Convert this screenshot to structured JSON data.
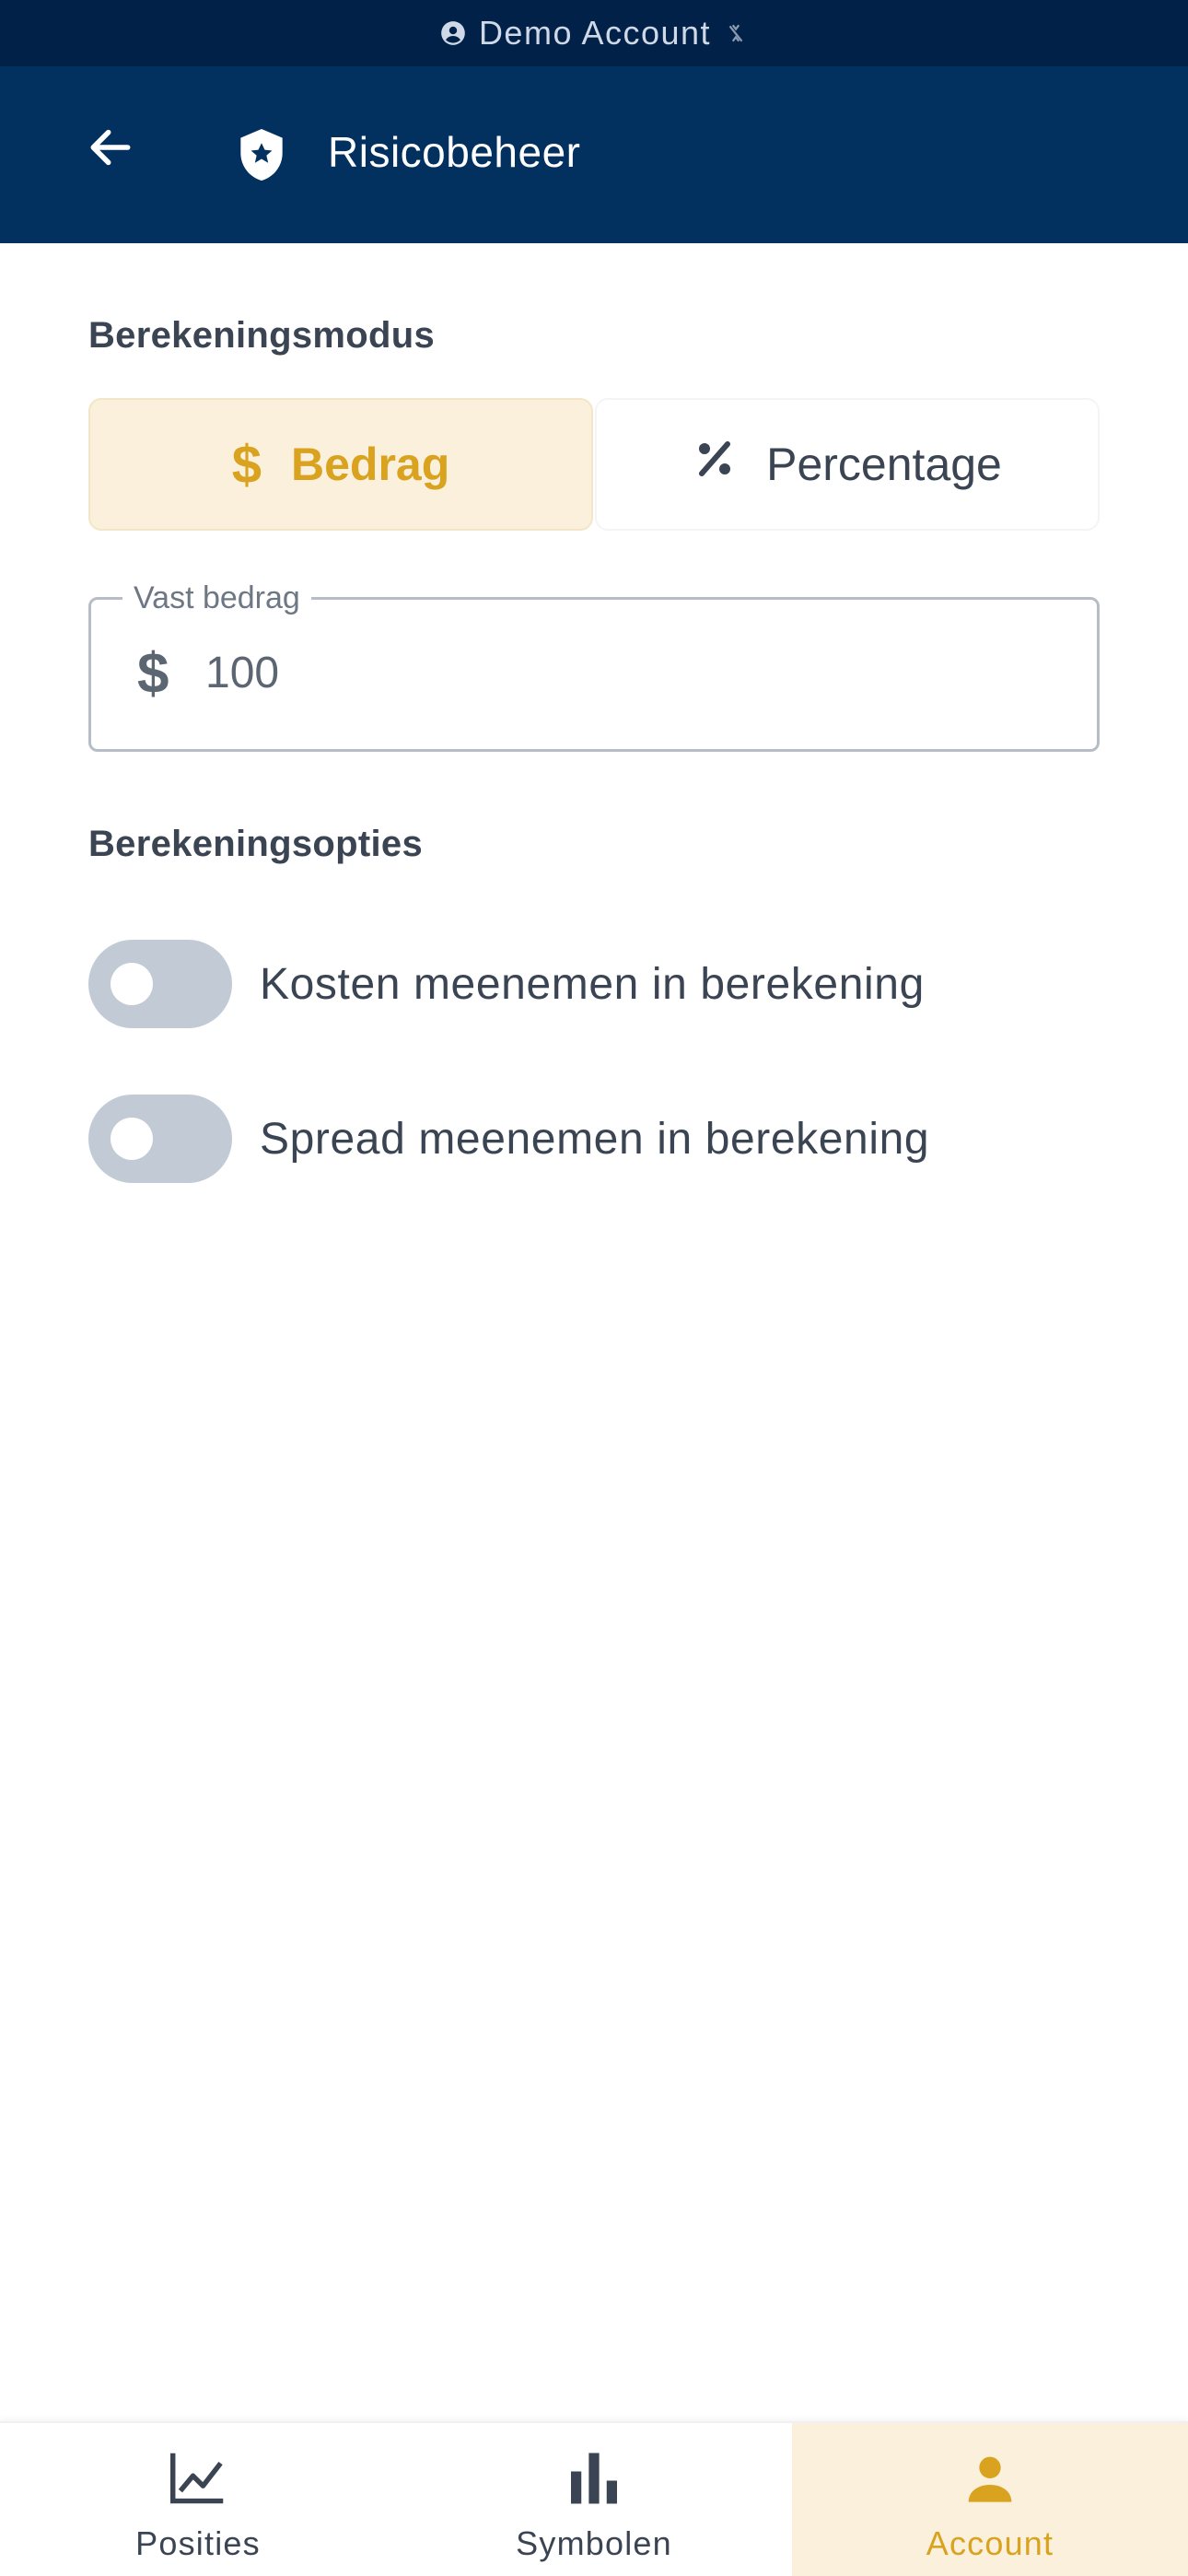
{
  "banner": {
    "text": "Demo Account",
    "user_icon": "account-circle-icon",
    "status_icon": "sync-off-icon"
  },
  "app_bar": {
    "title": "Risicobeheer",
    "back_icon": "arrow-left-icon",
    "title_icon": "shield-star-icon"
  },
  "mode": {
    "section_label": "Berekeningsmodus",
    "options": [
      {
        "label": "Bedrag",
        "icon": "dollar-icon",
        "selected": true
      },
      {
        "label": "Percentage",
        "icon": "percent-icon",
        "selected": false
      }
    ]
  },
  "amount_field": {
    "label": "Vast bedrag",
    "prefix": "$",
    "value": "100"
  },
  "options": {
    "section_label": "Berekeningsopties",
    "toggles": [
      {
        "label": "Kosten meenemen in berekening",
        "on": false
      },
      {
        "label": "Spread meenemen in berekening",
        "on": false
      }
    ]
  },
  "bottom_nav": {
    "items": [
      {
        "label": "Posities",
        "icon": "line-chart-icon",
        "active": false
      },
      {
        "label": "Symbolen",
        "icon": "bar-chart-icon",
        "active": false
      },
      {
        "label": "Account",
        "icon": "person-icon",
        "active": true
      }
    ]
  },
  "colors": {
    "banner_bg": "#012148",
    "app_bar_bg": "#02305f",
    "accent": "#d9a21f",
    "accent_bg": "#faf0db",
    "toggle_off": "#c2cad6",
    "text": "#3a4453"
  }
}
